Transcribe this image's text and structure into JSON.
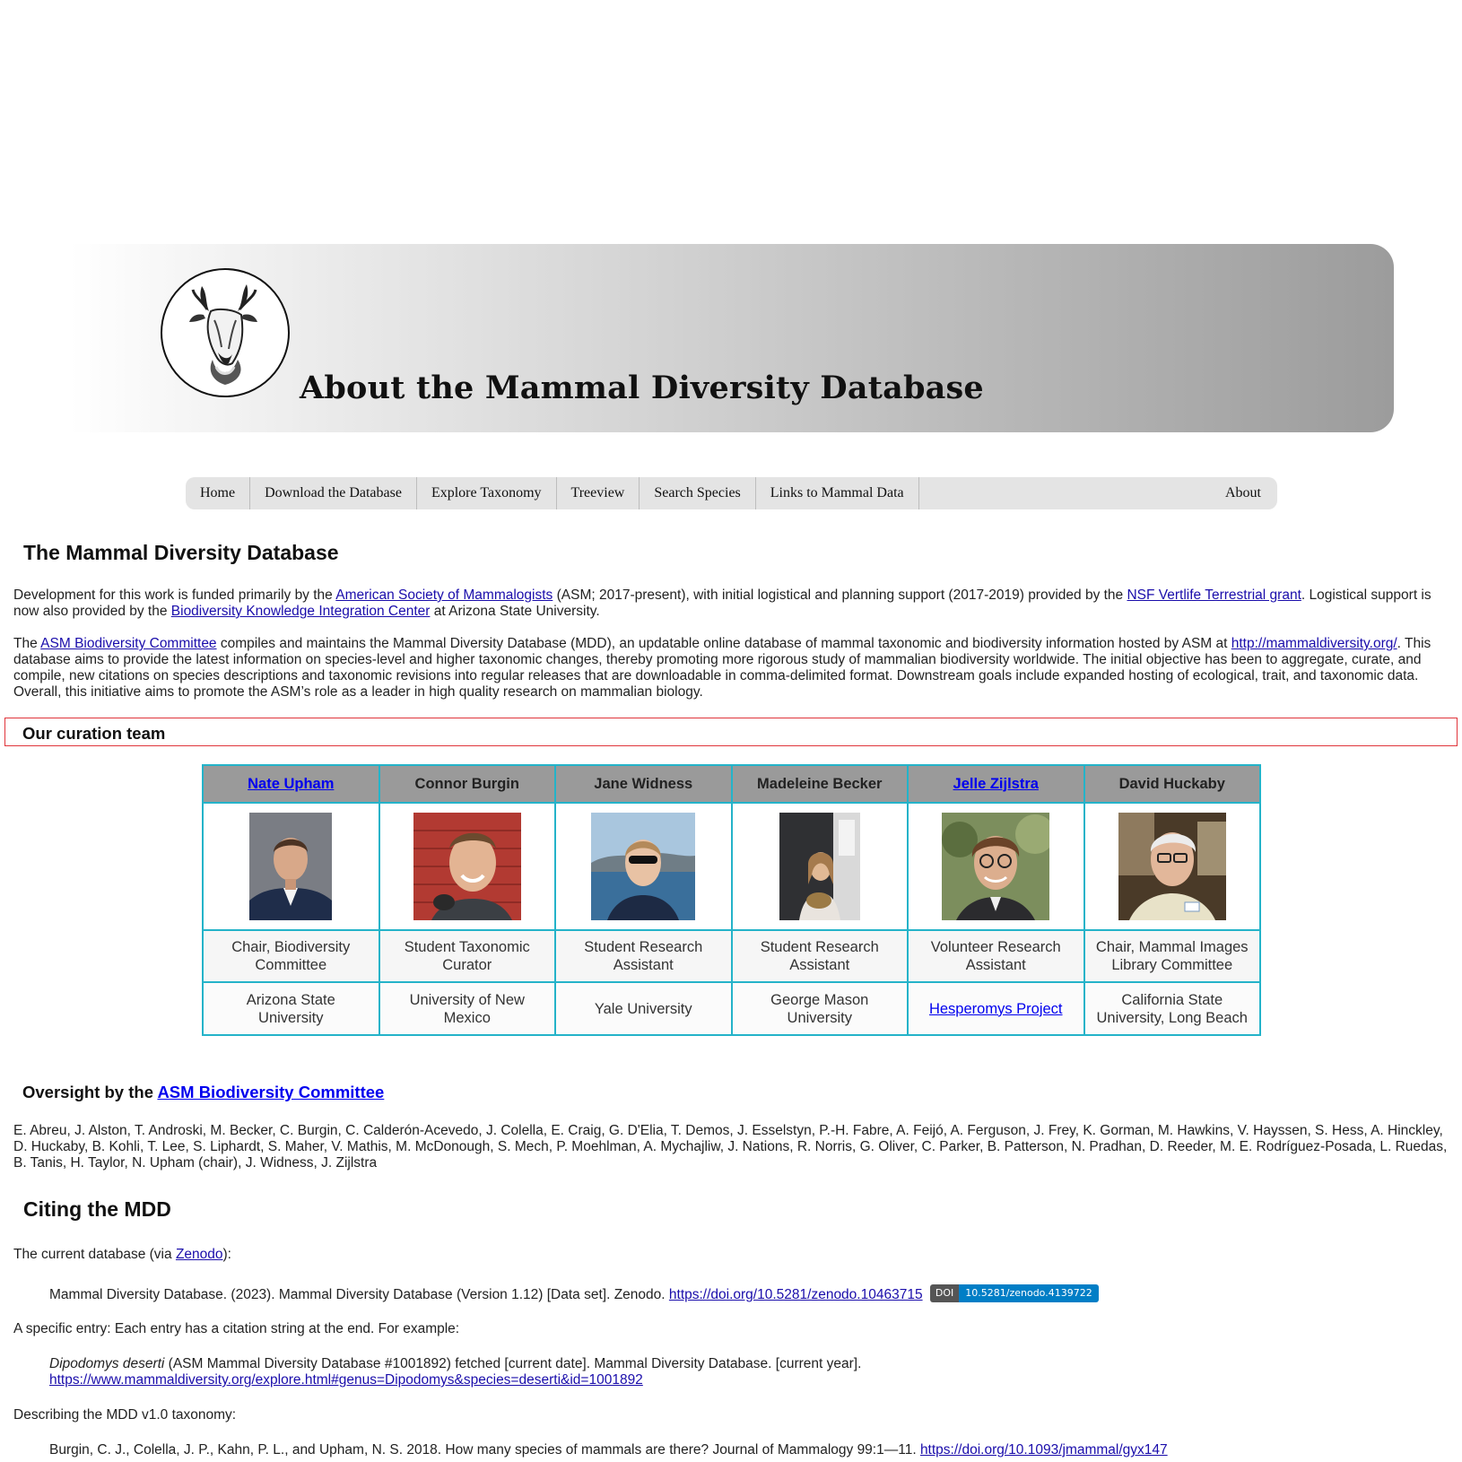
{
  "header": {
    "title": "About the Mammal Diversity Database"
  },
  "nav": {
    "items": [
      "Home",
      "Download the Database",
      "Explore Taxonomy",
      "Treeview",
      "Search Species",
      "Links to Mammal Data"
    ],
    "about": "About"
  },
  "intro": {
    "heading": "The Mammal Diversity Database",
    "p1": {
      "t1": "Development for this work is funded primarily by the ",
      "link1": "American Society of Mammalogists",
      "t2": " (ASM; 2017-present), with initial logistical and planning support (2017-2019) provided by the ",
      "link2": "NSF Vertlife Terrestrial grant",
      "t3": ". Logistical support is now also provided by the ",
      "link3": "Biodiversity Knowledge Integration Center",
      "t4": " at Arizona State University."
    },
    "p2": {
      "t1": "The ",
      "link1": "ASM Biodiversity Committee",
      "t2": " compiles and maintains the Mammal Diversity Database (MDD), an updatable online database of mammal taxonomic and biodiversity information hosted by ASM at ",
      "link2": "http://mammaldiversity.org/",
      "t3": ". This database aims to provide the latest information on species-level and higher taxonomic changes, thereby promoting more rigorous study of mammalian biodiversity worldwide. The initial objective has been to aggregate, curate, and compile, new citations on species descriptions and taxonomic revisions into regular releases that are downloadable in comma-delimited format. Downstream goals include expanded hosting of ecological, trait, and taxonomic data. Overall, this initiative aims to promote the ASM’s role as a leader in high quality research on mammalian biology."
    }
  },
  "team": {
    "heading": "Our curation team",
    "members": [
      {
        "name": "Nate Upham",
        "linked": true,
        "role": "Chair, Biodiversity Committee",
        "institution": "Arizona State University",
        "inst_linked": false
      },
      {
        "name": "Connor Burgin",
        "linked": false,
        "role": "Student Taxonomic Curator",
        "institution": "University of New Mexico",
        "inst_linked": false
      },
      {
        "name": "Jane Widness",
        "linked": false,
        "role": "Student Research Assistant",
        "institution": "Yale University",
        "inst_linked": false
      },
      {
        "name": "Madeleine Becker",
        "linked": false,
        "role": "Student Research Assistant",
        "institution": "George Mason University",
        "inst_linked": false
      },
      {
        "name": "Jelle Zijlstra",
        "linked": true,
        "role": "Volunteer Research Assistant",
        "institution": "Hesperomys Project",
        "inst_linked": true
      },
      {
        "name": "David Huckaby",
        "linked": false,
        "role": "Chair, Mammal Images Library Committee",
        "institution": "California State University, Long Beach",
        "inst_linked": false
      }
    ]
  },
  "oversight": {
    "heading_prefix": "Oversight by the ",
    "heading_link": "ASM Biodiversity Committee",
    "members": "E. Abreu, J. Alston, T. Androski, M. Becker, C. Burgin, C. Calderón-Acevedo, J. Colella, E. Craig, G. D'Elia, T. Demos, J. Esselstyn, P.-H. Fabre, A. Feijó, A. Ferguson, J. Frey, K. Gorman, M. Hawkins, V. Hayssen, S. Hess, A. Hinckley, D. Huckaby, B. Kohli, T. Lee, S. Liphardt, S. Maher, V. Mathis, M. McDonough, S. Mech, P. Moehlman, A. Mychajliw, J. Nations, R. Norris, G. Oliver, C. Parker, B. Patterson, N. Pradhan, D. Reeder, M. E. Rodríguez-Posada, L. Ruedas, B. Tanis, H. Taylor, N. Upham (chair), J. Widness, J. Zijlstra"
  },
  "citing": {
    "heading": "Citing the MDD",
    "current_prefix": "The current database (via ",
    "current_link": "Zenodo",
    "current_suffix": "):",
    "current_citation": "Mammal Diversity Database. (2023). Mammal Diversity Database (Version 1.12) [Data set]. Zenodo. ",
    "current_doi_link": "https://doi.org/10.5281/zenodo.10463715",
    "badge_left": "DOI",
    "badge_right": "10.5281/zenodo.4139722",
    "entry_intro": "A specific entry: Each entry has a citation string at the end. For example:",
    "entry_species": "Dipodomys deserti",
    "entry_text": " (ASM Mammal Diversity Database #1001892) fetched [current date]. Mammal Diversity Database. [current year].",
    "entry_link": "https://www.mammaldiversity.org/explore.html#genus=Dipodomys&species=deserti&id=1001892",
    "v1_intro": "Describing the MDD v1.0 taxonomy:",
    "v1_citation": "Burgin, C. J., Colella, J. P., Kahn, P. L., and Upham, N. S. 2018. How many species of mammals are there? Journal of Mammalogy 99:1—11. ",
    "v1_link": "https://doi.org/10.1093/jmammal/gyx147"
  }
}
